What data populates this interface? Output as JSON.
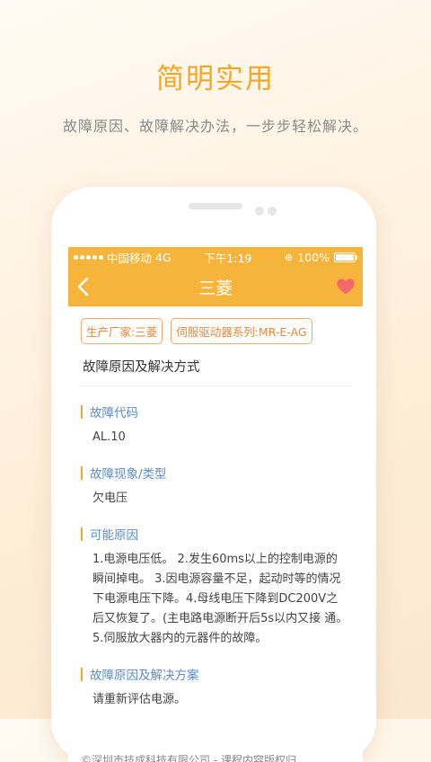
{
  "promo": {
    "title": "简明实用",
    "subtitle": "故障原因、故障解决办法，一步步轻松解决。"
  },
  "statusbar": {
    "carrier": "中国移动",
    "network": "4G",
    "time": "下午1:19",
    "battery": "100%"
  },
  "navbar": {
    "title": "三菱",
    "heart_color": "#f0696b"
  },
  "tags": [
    "生产厂家:三菱",
    "伺服驱动器系列:MR-E-AG"
  ],
  "section_title": "故障原因及解决方式",
  "fields": [
    {
      "label": "故障代码",
      "value": "AL.10"
    },
    {
      "label": "故障现象/类型",
      "value": "欠电压"
    },
    {
      "label": "可能原因",
      "value": "1.电源电压低。 2.发生60ms以上的控制电源的瞬间掉电。 3.因电源容量不足，起动时等的情况 下电源电压下降。4.母线电压下降到DC200V之后又恢复了。(主电路电源断开后5s以内又接 通。 5.伺服放大器内的元器件的故障。"
    },
    {
      "label": "故障原因及解决方案",
      "value": "请重新评估电源。"
    }
  ],
  "footer": "©深圳市技成科技有限公司 - 课程内容版权归"
}
